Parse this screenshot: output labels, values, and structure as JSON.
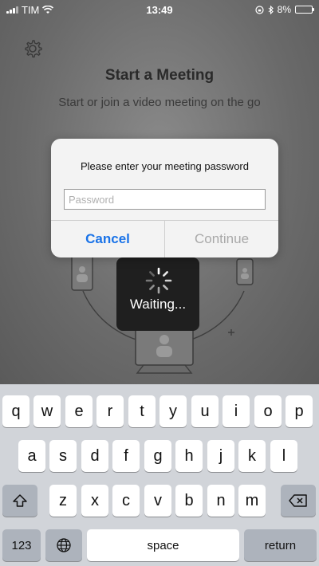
{
  "status_bar": {
    "carrier": "TIM",
    "time": "13:49",
    "battery": "8%",
    "battery_level": 0.08
  },
  "screen": {
    "title": "Start a Meeting",
    "subtitle": "Start or join a video meeting on the go",
    "loading_text": "Waiting..."
  },
  "dialog": {
    "message": "Please enter your meeting password",
    "input_placeholder": "Password",
    "input_value": "",
    "cancel_label": "Cancel",
    "continue_label": "Continue"
  },
  "keyboard": {
    "row1": [
      "q",
      "w",
      "e",
      "r",
      "t",
      "y",
      "u",
      "i",
      "o",
      "p"
    ],
    "row2": [
      "a",
      "s",
      "d",
      "f",
      "g",
      "h",
      "j",
      "k",
      "l"
    ],
    "row3": [
      "z",
      "x",
      "c",
      "v",
      "b",
      "n",
      "m"
    ],
    "numbers_label": "123",
    "space_label": "space",
    "return_label": "return",
    "shift_icon": "shift-arrow",
    "delete_icon": "backspace",
    "globe_icon": "globe"
  },
  "colors": {
    "accent": "#1a73e8",
    "disabled": "#a9a9a9",
    "battery_low": "#ff3b30"
  }
}
